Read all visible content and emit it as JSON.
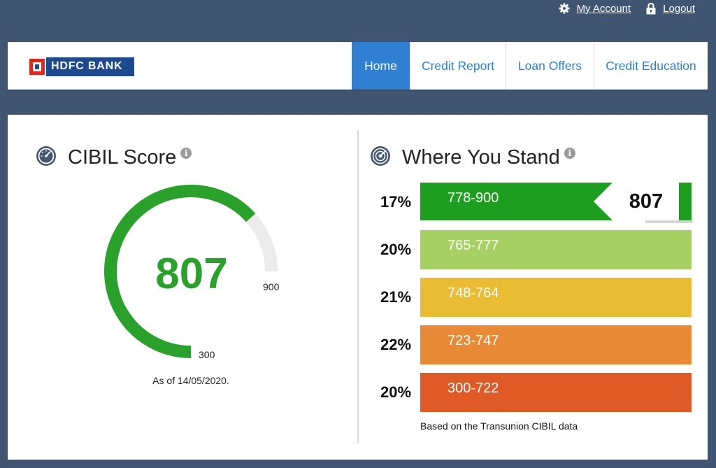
{
  "topbar": {
    "account_label": "My Account",
    "logout_label": "Logout"
  },
  "header": {
    "logo_text": "HDFC BANK",
    "nav": [
      {
        "label": "Home",
        "active": true
      },
      {
        "label": "Credit Report",
        "active": false
      },
      {
        "label": "Loan Offers",
        "active": false
      },
      {
        "label": "Credit Education",
        "active": false
      }
    ]
  },
  "cibil": {
    "title": "CIBIL Score",
    "info_glyph": "i",
    "score": "807",
    "min_label": "300",
    "max_label": "900",
    "as_of": "As of 14/05/2020.",
    "score_value": 807,
    "min_value": 300,
    "max_value": 900
  },
  "stand": {
    "title": "Where You Stand",
    "info_glyph": "i",
    "rows": [
      {
        "pct": "17%",
        "range": "778-900",
        "color": "#1e9e1e",
        "highlight": true
      },
      {
        "pct": "20%",
        "range": "765-777",
        "color": "#a6d162",
        "highlight": false
      },
      {
        "pct": "21%",
        "range": "748-764",
        "color": "#e9bc33",
        "highlight": false
      },
      {
        "pct": "22%",
        "range": "723-747",
        "color": "#e88a35",
        "highlight": false
      },
      {
        "pct": "20%",
        "range": "300-722",
        "color": "#e05a26",
        "highlight": false
      }
    ],
    "callout_score": "807",
    "footnote": "Based on the Transunion CIBIL data"
  },
  "colors": {
    "page_bg": "#3f5572",
    "nav_active": "#2f7fd2",
    "nav_text": "#2c7fcf",
    "gauge_fill": "#2aa12a",
    "gauge_track": "#ececec",
    "logo_blue": "#1d4a8f",
    "logo_red": "#e1261c"
  },
  "icons": {
    "account": "gear-icon",
    "logout": "lock-icon",
    "cibil": "speedometer-icon",
    "stand": "radar-icon"
  }
}
